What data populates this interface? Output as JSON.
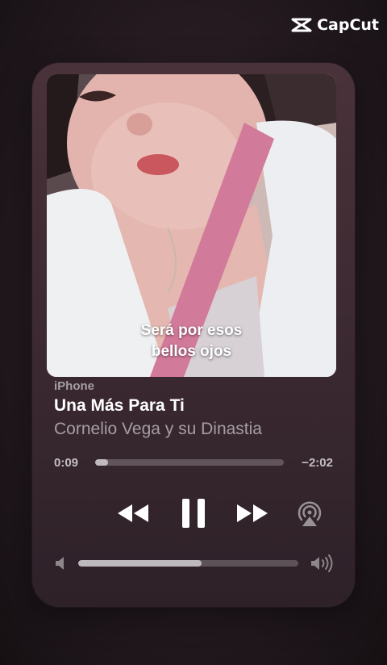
{
  "watermark": {
    "brand": "CapCut",
    "icon": "capcut-logo-icon"
  },
  "now_playing": {
    "source": "iPhone",
    "title": "Una Más Para Ti",
    "artist": "Cornelio Vega y su Dinastia",
    "lyric_line_1": "Será por esos",
    "lyric_line_2": "bellos ojos",
    "elapsed": "0:09",
    "remaining": "−2:02",
    "progress_fraction": 0.07,
    "volume_fraction": 0.56
  },
  "controls": {
    "rewind_icon": "rewind-icon",
    "pause_icon": "pause-icon",
    "forward_icon": "fast-forward-icon",
    "airplay_icon": "airplay-icon",
    "volume_low_icon": "volume-low-icon",
    "volume_high_icon": "volume-high-icon"
  }
}
